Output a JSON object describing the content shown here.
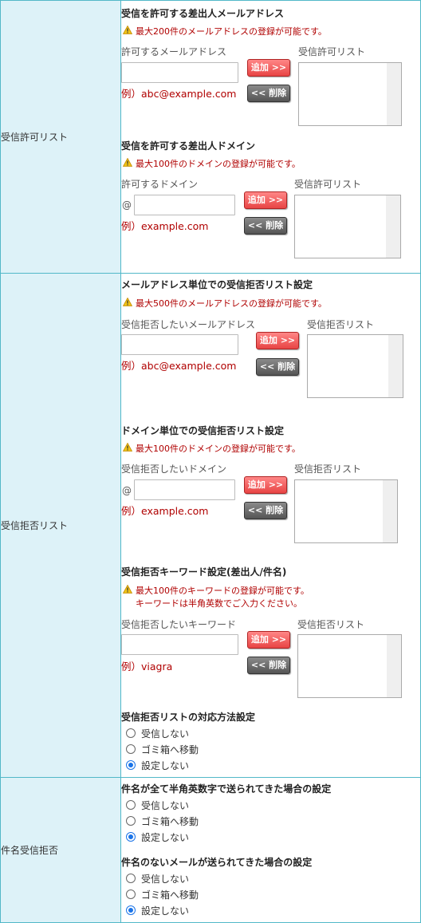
{
  "rows": {
    "allow": {
      "label": "受信許可リスト",
      "address": {
        "title": "受信を許可する差出人メールアドレス",
        "warning": "最大200件のメールアドレスの登録が可能です。",
        "input_label": "許可するメールアドレス",
        "example": "例）abc@example.com",
        "list_label": "受信許可リスト"
      },
      "domain": {
        "title": "受信を許可する差出人ドメイン",
        "warning": "最大100件のドメインの登録が可能です。",
        "input_label": "許可するドメイン",
        "at": "@",
        "example": "例）example.com",
        "list_label": "受信許可リスト"
      }
    },
    "reject": {
      "label": "受信拒否リスト",
      "address": {
        "title": "メールアドレス単位での受信拒否リスト設定",
        "warning": "最大500件のメールアドレスの登録が可能です。",
        "input_label": "受信拒否したいメールアドレス",
        "example": "例）abc@example.com",
        "list_label": "受信拒否リスト"
      },
      "domain": {
        "title": "ドメイン単位での受信拒否リスト設定",
        "warning": "最大100件のドメインの登録が可能です。",
        "input_label": "受信拒否したいドメイン",
        "at": "@",
        "example": "例）example.com",
        "list_label": "受信拒否リスト"
      },
      "keyword": {
        "title": "受信拒否キーワード設定(差出人/件名)",
        "warning_line1": "最大100件のキーワードの登録が可能です。",
        "warning_line2": "キーワードは半角英数でご入力ください。",
        "input_label": "受信拒否したいキーワード",
        "example": "例）viagra",
        "list_label": "受信拒否リスト"
      },
      "handling": {
        "title": "受信拒否リストの対応方法設定",
        "options": [
          "受信しない",
          "ゴミ箱へ移動",
          "設定しない"
        ],
        "selected": "設定しない"
      }
    },
    "subject": {
      "label": "件名受信拒否",
      "alnum": {
        "title": "件名が全て半角英数字で送られてきた場合の設定",
        "options": [
          "受信しない",
          "ゴミ箱へ移動",
          "設定しない"
        ],
        "selected": "設定しない"
      },
      "empty": {
        "title": "件名のないメールが送られてきた場合の設定",
        "options": [
          "受信しない",
          "ゴミ箱へ移動",
          "設定しない"
        ],
        "selected": "設定しない"
      }
    }
  },
  "buttons": {
    "add": "追加 >>",
    "delete": "<< 削除"
  },
  "colors": {
    "border": "#52b8c8",
    "label_bg": "#ddf2f8",
    "warning": "#b00000",
    "add_btn": "#e84545",
    "delete_btn": "#555555",
    "radio_selected": "#1a73e8"
  },
  "icons": {
    "warning": "warning-triangle-icon"
  }
}
